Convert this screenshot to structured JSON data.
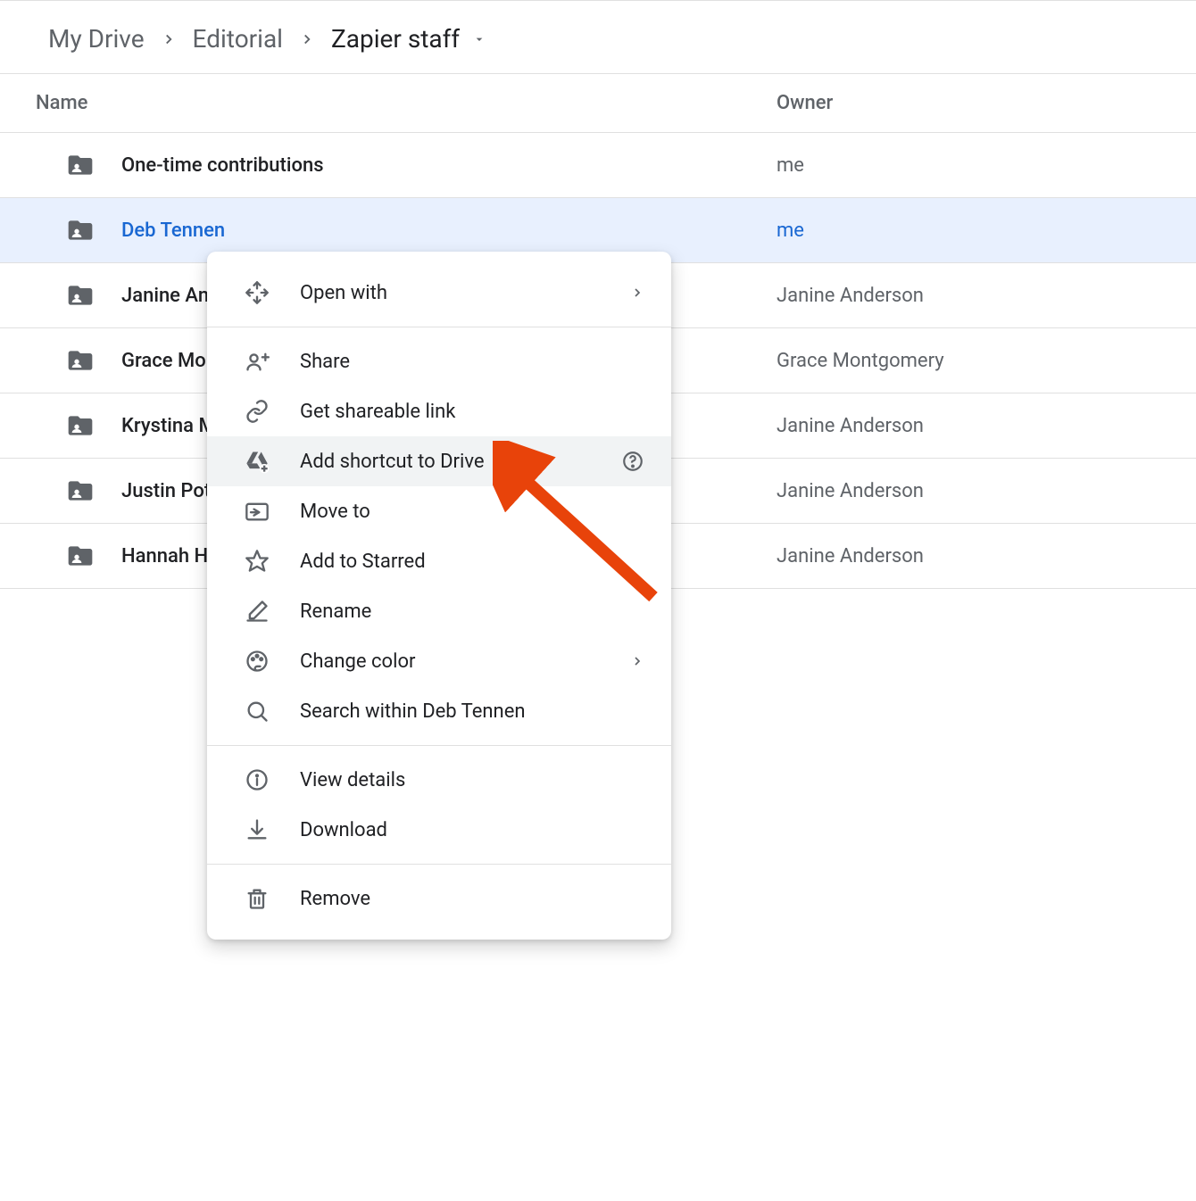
{
  "breadcrumb": {
    "items": [
      {
        "label": "My Drive"
      },
      {
        "label": "Editorial"
      },
      {
        "label": "Zapier staff"
      }
    ]
  },
  "table": {
    "headers": {
      "name": "Name",
      "owner": "Owner"
    },
    "rows": [
      {
        "name": "One-time contributions",
        "owner": "me",
        "selected": false
      },
      {
        "name": "Deb Tennen",
        "owner": "me",
        "selected": true
      },
      {
        "name": "Janine Anderson",
        "owner": "Janine Anderson",
        "selected": false
      },
      {
        "name": "Grace Montgomery",
        "owner": "Grace Montgomery",
        "selected": false
      },
      {
        "name": "Krystina Martinez",
        "owner": "Janine Anderson",
        "selected": false
      },
      {
        "name": "Justin Pot",
        "owner": "Janine Anderson",
        "selected": false
      },
      {
        "name": "Hannah Herman",
        "owner": "Janine Anderson",
        "selected": false
      }
    ]
  },
  "menu": {
    "items": [
      {
        "icon": "open-with",
        "label": "Open with",
        "chevron": true
      },
      {
        "divider": true
      },
      {
        "icon": "share",
        "label": "Share"
      },
      {
        "icon": "link",
        "label": "Get shareable link"
      },
      {
        "icon": "drive-add",
        "label": "Add shortcut to Drive",
        "help": true,
        "highlighted": true
      },
      {
        "icon": "move",
        "label": "Move to"
      },
      {
        "icon": "star",
        "label": "Add to Starred"
      },
      {
        "icon": "rename",
        "label": "Rename"
      },
      {
        "icon": "palette",
        "label": "Change color",
        "chevron": true
      },
      {
        "icon": "search",
        "label": "Search within Deb Tennen"
      },
      {
        "divider": true
      },
      {
        "icon": "info",
        "label": "View details"
      },
      {
        "icon": "download",
        "label": "Download"
      },
      {
        "divider": true
      },
      {
        "icon": "trash",
        "label": "Remove"
      }
    ]
  }
}
